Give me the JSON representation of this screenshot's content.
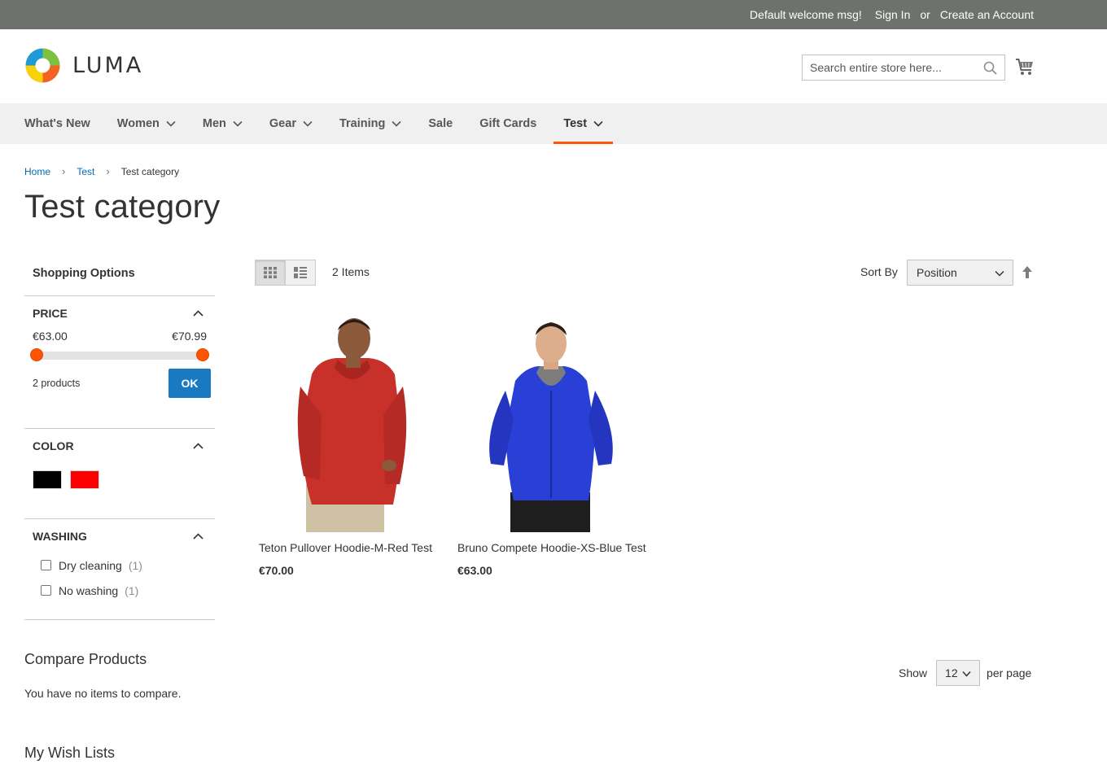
{
  "topbar": {
    "welcome": "Default welcome msg!",
    "sign_in": "Sign In",
    "or": "or",
    "create_account": "Create an Account"
  },
  "header": {
    "logo_text": "LUMA",
    "search_placeholder": "Search entire store here...",
    "search_icon": "search-icon",
    "cart_icon": "cart-icon"
  },
  "nav": {
    "items": [
      {
        "label": "What's New",
        "has_dropdown": false
      },
      {
        "label": "Women",
        "has_dropdown": true
      },
      {
        "label": "Men",
        "has_dropdown": true
      },
      {
        "label": "Gear",
        "has_dropdown": true
      },
      {
        "label": "Training",
        "has_dropdown": true
      },
      {
        "label": "Sale",
        "has_dropdown": false
      },
      {
        "label": "Gift Cards",
        "has_dropdown": false
      },
      {
        "label": "Test",
        "has_dropdown": true,
        "active": true
      }
    ],
    "active_color": "#ff5501"
  },
  "breadcrumbs": {
    "home": "Home",
    "parent": "Test",
    "current": "Test category",
    "separator": "›"
  },
  "page_title": "Test category",
  "sidebar": {
    "title": "Shopping Options",
    "price": {
      "title": "PRICE",
      "min": "€63.00",
      "max": "€70.99",
      "count_text": "2 products",
      "ok_label": "OK"
    },
    "color": {
      "title": "COLOR",
      "swatches": [
        "#000000",
        "#ff0000"
      ]
    },
    "washing": {
      "title": "WASHING",
      "options": [
        {
          "label": "Dry cleaning",
          "count": "(1)"
        },
        {
          "label": "No washing",
          "count": "(1)"
        }
      ]
    }
  },
  "compare": {
    "title": "Compare Products",
    "empty": "You have no items to compare."
  },
  "wishlist": {
    "title": "My Wish Lists"
  },
  "toolbar": {
    "item_count": "2 Items",
    "sort_label": "Sort By",
    "sort_value": "Position",
    "show_label": "Show",
    "per_page_value": "12",
    "per_page_label": "per page"
  },
  "products": [
    {
      "name": "Teton Pullover Hoodie-M-Red Test",
      "price": "€70.00",
      "color": "#c8302a"
    },
    {
      "name": "Bruno Compete Hoodie-XS-Blue Test",
      "price": "€63.00",
      "color": "#2a3fd6"
    }
  ],
  "colors": {
    "topbar": "#6e716e",
    "link": "#006bb4",
    "button": "#1979c3",
    "accent": "#ff5501"
  }
}
